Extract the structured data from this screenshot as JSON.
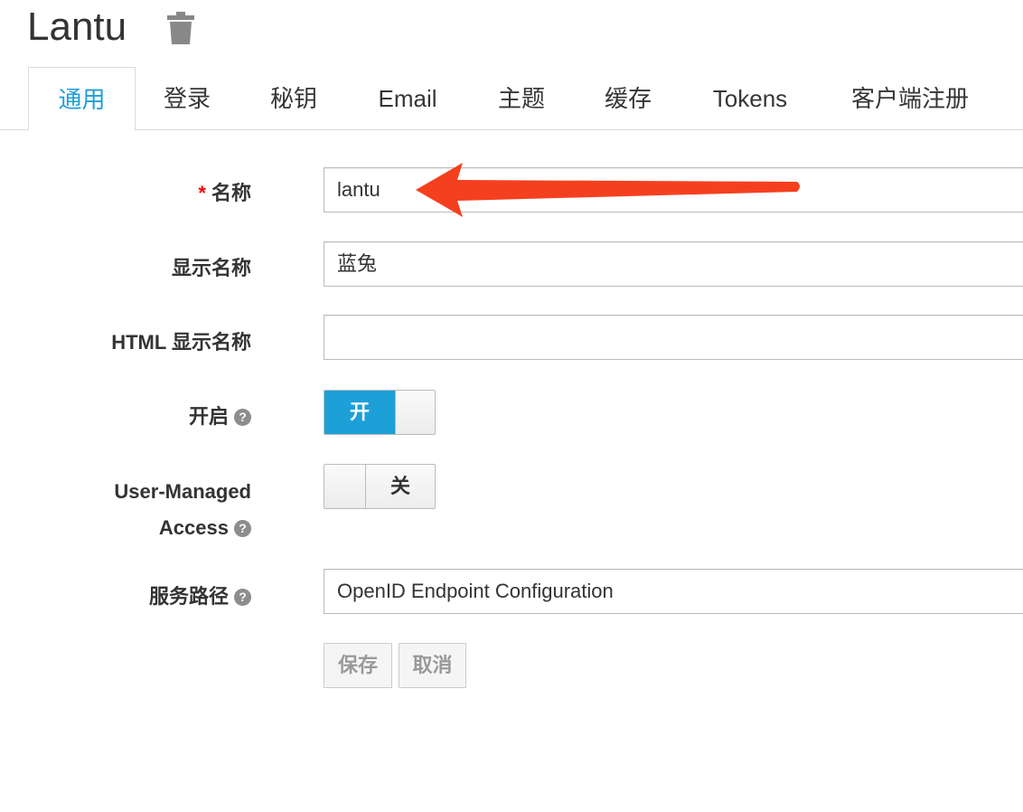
{
  "header": {
    "title": "Lantu",
    "delete_icon": "trash-icon"
  },
  "tabs": [
    {
      "label": "通用",
      "active": true
    },
    {
      "label": "登录"
    },
    {
      "label": "秘钥"
    },
    {
      "label": "Email"
    },
    {
      "label": "主题"
    },
    {
      "label": "缓存"
    },
    {
      "label": "Tokens"
    },
    {
      "label": "客户端注册"
    }
  ],
  "form": {
    "name": {
      "label": "名称",
      "required_mark": "*",
      "value": "lantu"
    },
    "display_name": {
      "label": "显示名称",
      "value": "蓝兔"
    },
    "html_display_name": {
      "label": "HTML 显示名称",
      "value": ""
    },
    "enabled": {
      "label": "开启",
      "state": "on",
      "on_label": "开"
    },
    "uma": {
      "label_line1": "User-Managed",
      "label_line2": "Access",
      "state": "off",
      "off_label": "关"
    },
    "endpoints": {
      "label": "服务路径",
      "value": "OpenID Endpoint Configuration"
    },
    "save_label": "保存",
    "cancel_label": "取消"
  },
  "colors": {
    "accent": "#1d9fd8",
    "annotation_arrow": "#f5401f",
    "required": "#e00000"
  },
  "annotation": {
    "type": "arrow",
    "points_to": "name-input"
  }
}
